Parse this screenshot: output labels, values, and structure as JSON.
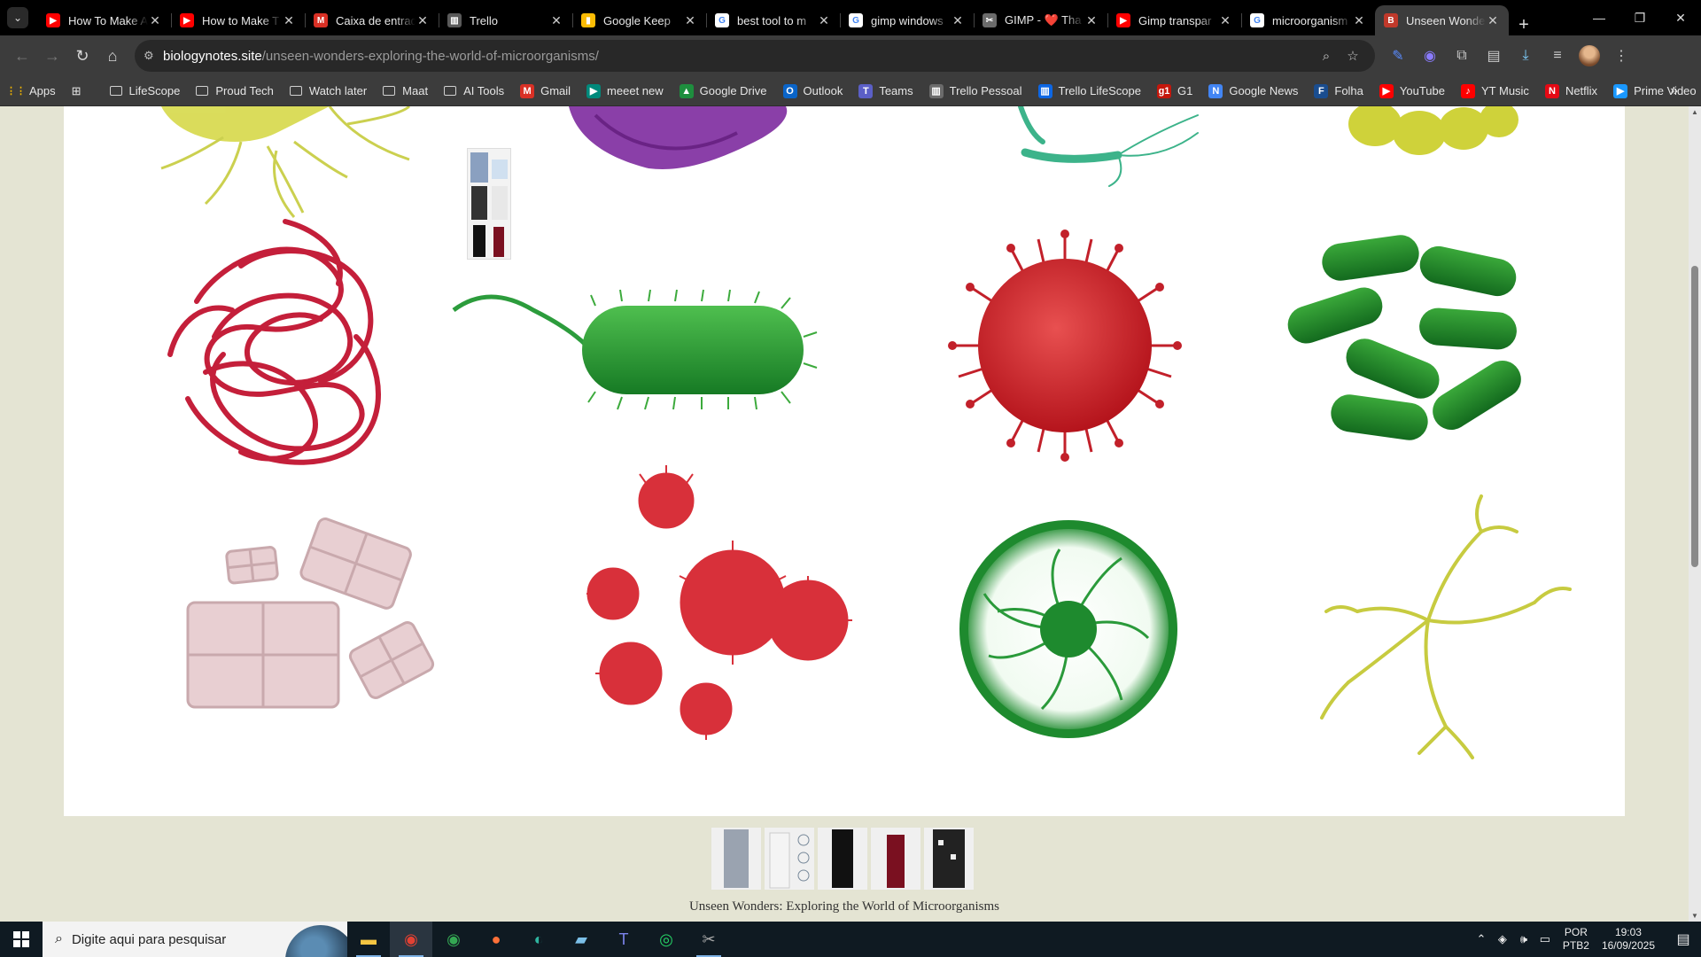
{
  "browser": {
    "tabs": [
      {
        "title": "How To Make A",
        "icon": "youtube-icon",
        "color": "#ff0000",
        "glyph": "▶"
      },
      {
        "title": "How to Make T",
        "icon": "youtube-icon",
        "color": "#ff0000",
        "glyph": "▶"
      },
      {
        "title": "Caixa de entrada",
        "icon": "gmail-icon",
        "color": "#d93025",
        "glyph": "M"
      },
      {
        "title": "Trello",
        "icon": "trello-icon",
        "color": "#5a5a5a",
        "glyph": "▥"
      },
      {
        "title": "Google Keep",
        "icon": "keep-icon",
        "color": "#fbbc04",
        "glyph": "▮"
      },
      {
        "title": "best tool to m",
        "icon": "google-icon",
        "color": "#ffffff",
        "glyph": "G"
      },
      {
        "title": "gimp windows",
        "icon": "google-icon",
        "color": "#ffffff",
        "glyph": "G"
      },
      {
        "title": "GIMP - ❤️ Tha",
        "icon": "gimp-icon",
        "color": "#6b6b6b",
        "glyph": "✂"
      },
      {
        "title": "Gimp transpar",
        "icon": "youtube-icon",
        "color": "#ff0000",
        "glyph": "▶"
      },
      {
        "title": "microorganism",
        "icon": "google-icon",
        "color": "#ffffff",
        "glyph": "G"
      },
      {
        "title": "Unseen Wonde",
        "icon": "site-icon",
        "color": "#c0392b",
        "glyph": "B",
        "active": true
      }
    ],
    "url_host": "biologynotes.site",
    "url_path": "/unseen-wonders-exploring-the-world-of-microorganisms/",
    "bookmarks": [
      {
        "label": "Apps",
        "type": "apps"
      },
      {
        "label": "LifeScope",
        "type": "folder"
      },
      {
        "label": "Proud Tech",
        "type": "folder"
      },
      {
        "label": "Watch later",
        "type": "folder"
      },
      {
        "label": "Maat",
        "type": "folder"
      },
      {
        "label": "AI Tools",
        "type": "folder"
      },
      {
        "label": "Gmail",
        "type": "icon",
        "color": "#d93025",
        "glyph": "M"
      },
      {
        "label": "meeet new",
        "type": "icon",
        "color": "#00897b",
        "glyph": "▶"
      },
      {
        "label": "Google Drive",
        "type": "icon",
        "color": "#1e8e3e",
        "glyph": "▲"
      },
      {
        "label": "Outlook",
        "type": "icon",
        "color": "#0a64c8",
        "glyph": "O"
      },
      {
        "label": "Teams",
        "type": "icon",
        "color": "#5b5fc7",
        "glyph": "T"
      },
      {
        "label": "Trello Pessoal",
        "type": "icon",
        "color": "#6b6b6b",
        "glyph": "▥"
      },
      {
        "label": "Trello LifeScope",
        "type": "icon",
        "color": "#0c66e4",
        "glyph": "▥"
      },
      {
        "label": "G1",
        "type": "icon",
        "color": "#c4170c",
        "glyph": "g1"
      },
      {
        "label": "Google News",
        "type": "icon",
        "color": "#4285f4",
        "glyph": "N"
      },
      {
        "label": "Folha",
        "type": "icon",
        "color": "#1a4d8f",
        "glyph": "F"
      },
      {
        "label": "YouTube",
        "type": "icon",
        "color": "#ff0000",
        "glyph": "▶"
      },
      {
        "label": "YT Music",
        "type": "icon",
        "color": "#ff0000",
        "glyph": "♪"
      },
      {
        "label": "Netflix",
        "type": "icon",
        "color": "#e50914",
        "glyph": "N"
      },
      {
        "label": "Prime Video",
        "type": "icon",
        "color": "#1a98ff",
        "glyph": "▶"
      }
    ]
  },
  "page": {
    "caption": "Unseen Wonders: Exploring the World of Microorganisms"
  },
  "taskbar": {
    "search_placeholder": "Digite aqui para pesquisar",
    "lang_line1": "POR",
    "lang_line2": "PTB2",
    "time": "19:03",
    "date": "16/09/2025"
  }
}
